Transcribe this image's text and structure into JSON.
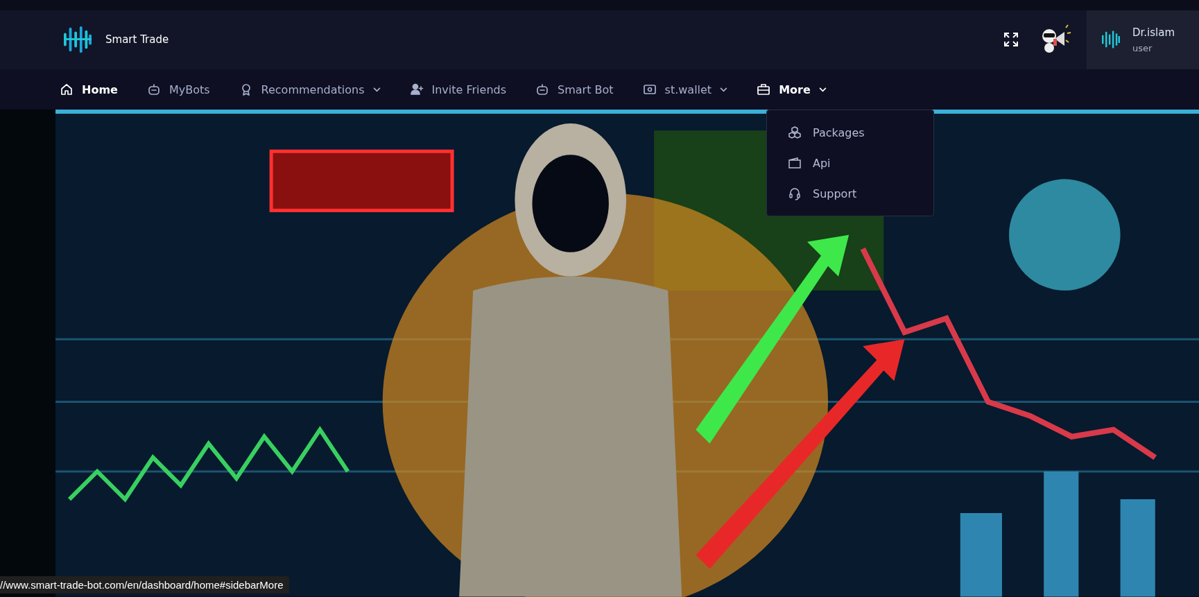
{
  "brand": {
    "name": "Smart Trade"
  },
  "user": {
    "name": "Dr.islam",
    "role": "user"
  },
  "nav": [
    {
      "label": "Home",
      "kind": "home",
      "selected": true,
      "caret": false
    },
    {
      "label": "MyBots",
      "kind": "robot",
      "selected": false,
      "caret": false
    },
    {
      "label": "Recommendations",
      "kind": "award",
      "selected": false,
      "caret": true
    },
    {
      "label": "Invite Friends",
      "kind": "invite",
      "selected": false,
      "caret": false
    },
    {
      "label": "Smart Bot",
      "kind": "robot",
      "selected": false,
      "caret": false
    },
    {
      "label": "st.wallet",
      "kind": "wallet",
      "selected": false,
      "caret": true
    },
    {
      "label": "More",
      "kind": "briefcase",
      "selected": true,
      "caret": true,
      "expanded": true
    }
  ],
  "dropdown": [
    {
      "label": "Packages",
      "kind": "boxes"
    },
    {
      "label": "Api",
      "kind": "folder"
    },
    {
      "label": "Support",
      "kind": "headset"
    }
  ],
  "status_url": "//www.smart-trade-bot.com/en/dashboard/home#sidebarMore"
}
